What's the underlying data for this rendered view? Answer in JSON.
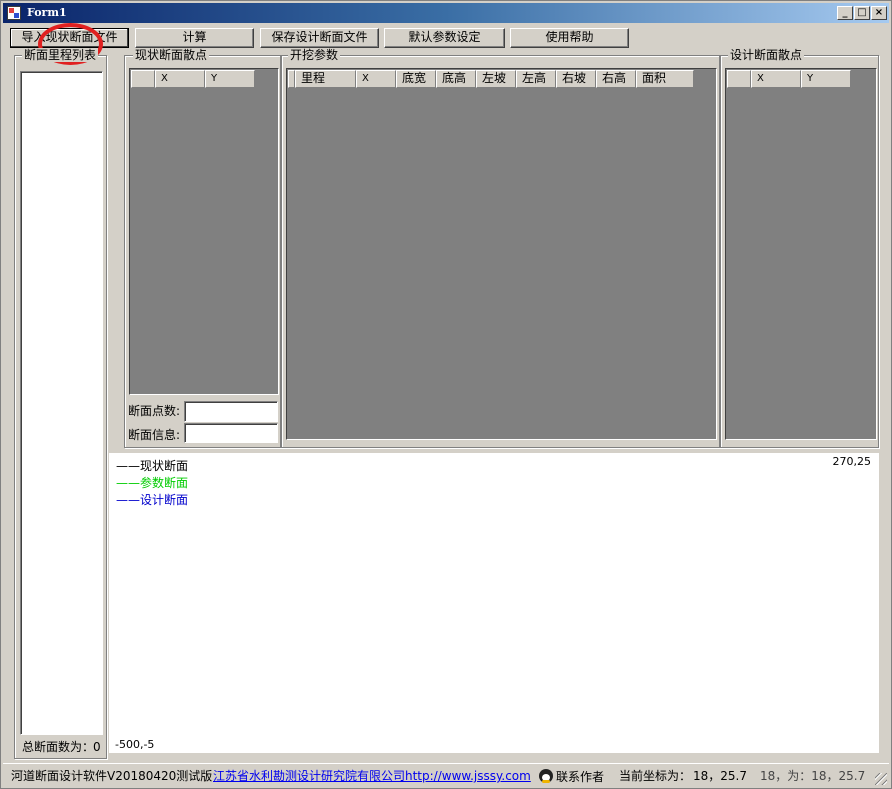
{
  "window": {
    "title": "Form1",
    "minimize_label": "_",
    "maximize_label": "□",
    "close_label": "×"
  },
  "toolbar": {
    "import_label": "导入现状断面文件",
    "calculate_label": "计算",
    "save_label": "保存设计断面文件",
    "defaults_label": "默认参数设定",
    "help_label": "使用帮助"
  },
  "section_list": {
    "title": "断面里程列表",
    "count_label": "总断面数为：",
    "count_value": "0"
  },
  "current_points": {
    "title": "现状断面散点",
    "columns": [
      "X",
      "Y"
    ],
    "point_count_label": "断面点数:",
    "point_count_value": "",
    "info_label": "断面信息:",
    "info_value": ""
  },
  "excavation": {
    "title": "开挖参数",
    "columns": [
      "里程",
      "X",
      "底宽",
      "底高",
      "左坡",
      "左高",
      "右坡",
      "右高",
      "面积"
    ]
  },
  "design_points": {
    "title": "设计断面散点",
    "columns": [
      "X",
      "Y"
    ]
  },
  "plot": {
    "legend": [
      {
        "label": "——现状断面",
        "color": "#000000"
      },
      {
        "label": "——参数断面",
        "color": "#00cc00"
      },
      {
        "label": "——设计断面",
        "color": "#0000cc"
      }
    ],
    "top_right_coord": "270,25",
    "bottom_left_coord": "-500,-5"
  },
  "statusbar": {
    "version": "河道断面设计软件V20180420测试版",
    "org_link": "江苏省水利勘测设计研究院有限公司http://www.jsssy.com",
    "contact_label": "联系作者",
    "current_coord_label": "当前坐标为：",
    "current_coord_value": "18，25.7",
    "extra_coord": "18，为：18，25.7"
  }
}
